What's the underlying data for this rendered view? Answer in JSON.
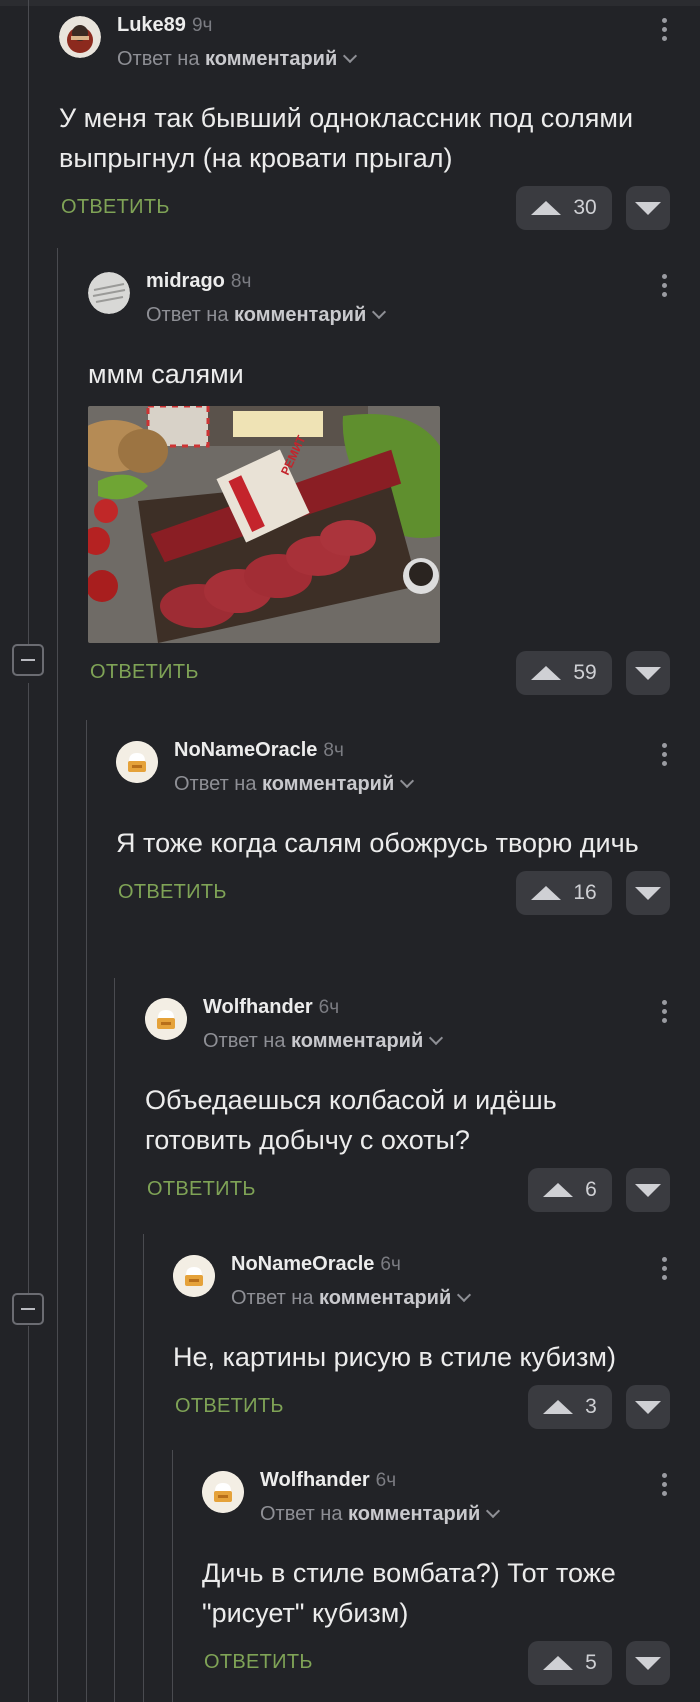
{
  "thread": {
    "reply_to_prefix": "Ответ на",
    "reply_to_target": "комментарий",
    "reply_label": "ОТВЕТИТЬ"
  },
  "comments": [
    {
      "user": "Luke89",
      "time": "9ч",
      "text": "У меня так бывший одноклассник под солями выпрыгнул (на кровати прыгал)",
      "votes": "30"
    },
    {
      "user": "midrago",
      "time": "8ч",
      "text": "ммм салями",
      "votes": "59",
      "image": "salami-photo"
    },
    {
      "user": "NoNameOracle",
      "time": "8ч",
      "text": "Я тоже когда салям обожрусь творю дичь",
      "votes": "16"
    },
    {
      "user": "Wolfhander",
      "time": "6ч",
      "text": "Объедаешься колбасой и идёшь готовить добычу с охоты?",
      "votes": "6"
    },
    {
      "user": "NoNameOracle",
      "time": "6ч",
      "text": "Не, картины рисую в стиле кубизм)",
      "votes": "3"
    },
    {
      "user": "Wolfhander",
      "time": "6ч",
      "text": "Дичь в стиле вомбата?) Тот тоже \"рисует\" кубизм)",
      "votes": "5"
    }
  ],
  "image_label": {
    "brand": "РЕМИТ"
  },
  "colors": {
    "background": "#222327",
    "reply": "#7fa356",
    "button": "#3a3b40"
  }
}
